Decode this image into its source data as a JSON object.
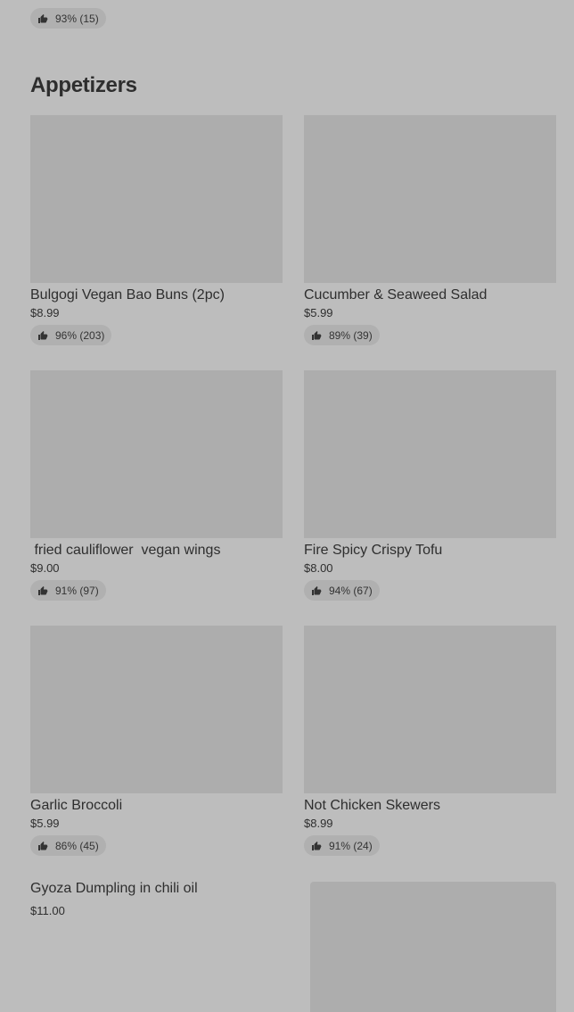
{
  "top_item": {
    "rating": "93% (15)"
  },
  "section": {
    "title": "Appetizers"
  },
  "items": [
    {
      "name": "Bulgogi Vegan Bao Buns (2pc)",
      "price": "$8.99",
      "rating": "96% (203)"
    },
    {
      "name": "Cucumber & Seaweed Salad",
      "price": "$5.99",
      "rating": "89% (39)"
    },
    {
      "name": " fried cauliflower  vegan wings",
      "price": "$9.00",
      "rating": "91% (97)"
    },
    {
      "name": "Fire Spicy Crispy Tofu",
      "price": "$8.00",
      "rating": "94% (67)"
    },
    {
      "name": "Garlic Broccoli",
      "price": "$5.99",
      "rating": "86% (45)"
    },
    {
      "name": "Not Chicken Skewers",
      "price": "$8.99",
      "rating": "91% (24)"
    }
  ],
  "wide_item": {
    "name": "Gyoza Dumpling in chili oil",
    "price": "$11.00"
  },
  "icons": {
    "rating": "thumbs-up-icon"
  },
  "colors": {
    "background": "#bdbdbd",
    "image_placeholder": "#adadad",
    "rating_pill": "#b0b0b0",
    "text": "#2e2e2e"
  }
}
